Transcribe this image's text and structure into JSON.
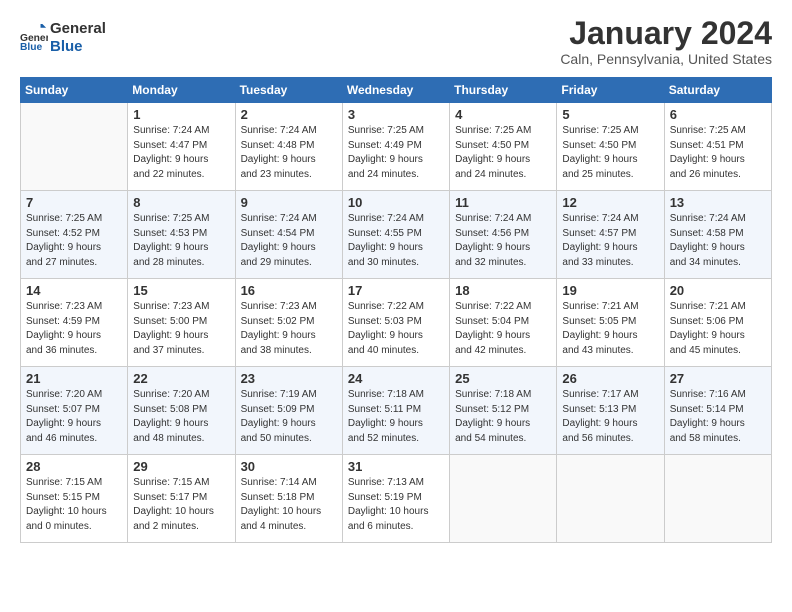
{
  "header": {
    "logo_line1": "General",
    "logo_line2": "Blue",
    "title": "January 2024",
    "location": "Caln, Pennsylvania, United States"
  },
  "days_of_week": [
    "Sunday",
    "Monday",
    "Tuesday",
    "Wednesday",
    "Thursday",
    "Friday",
    "Saturday"
  ],
  "weeks": [
    [
      {
        "num": "",
        "info": ""
      },
      {
        "num": "1",
        "info": "Sunrise: 7:24 AM\nSunset: 4:47 PM\nDaylight: 9 hours\nand 22 minutes."
      },
      {
        "num": "2",
        "info": "Sunrise: 7:24 AM\nSunset: 4:48 PM\nDaylight: 9 hours\nand 23 minutes."
      },
      {
        "num": "3",
        "info": "Sunrise: 7:25 AM\nSunset: 4:49 PM\nDaylight: 9 hours\nand 24 minutes."
      },
      {
        "num": "4",
        "info": "Sunrise: 7:25 AM\nSunset: 4:50 PM\nDaylight: 9 hours\nand 24 minutes."
      },
      {
        "num": "5",
        "info": "Sunrise: 7:25 AM\nSunset: 4:50 PM\nDaylight: 9 hours\nand 25 minutes."
      },
      {
        "num": "6",
        "info": "Sunrise: 7:25 AM\nSunset: 4:51 PM\nDaylight: 9 hours\nand 26 minutes."
      }
    ],
    [
      {
        "num": "7",
        "info": "Sunrise: 7:25 AM\nSunset: 4:52 PM\nDaylight: 9 hours\nand 27 minutes."
      },
      {
        "num": "8",
        "info": "Sunrise: 7:25 AM\nSunset: 4:53 PM\nDaylight: 9 hours\nand 28 minutes."
      },
      {
        "num": "9",
        "info": "Sunrise: 7:24 AM\nSunset: 4:54 PM\nDaylight: 9 hours\nand 29 minutes."
      },
      {
        "num": "10",
        "info": "Sunrise: 7:24 AM\nSunset: 4:55 PM\nDaylight: 9 hours\nand 30 minutes."
      },
      {
        "num": "11",
        "info": "Sunrise: 7:24 AM\nSunset: 4:56 PM\nDaylight: 9 hours\nand 32 minutes."
      },
      {
        "num": "12",
        "info": "Sunrise: 7:24 AM\nSunset: 4:57 PM\nDaylight: 9 hours\nand 33 minutes."
      },
      {
        "num": "13",
        "info": "Sunrise: 7:24 AM\nSunset: 4:58 PM\nDaylight: 9 hours\nand 34 minutes."
      }
    ],
    [
      {
        "num": "14",
        "info": "Sunrise: 7:23 AM\nSunset: 4:59 PM\nDaylight: 9 hours\nand 36 minutes."
      },
      {
        "num": "15",
        "info": "Sunrise: 7:23 AM\nSunset: 5:00 PM\nDaylight: 9 hours\nand 37 minutes."
      },
      {
        "num": "16",
        "info": "Sunrise: 7:23 AM\nSunset: 5:02 PM\nDaylight: 9 hours\nand 38 minutes."
      },
      {
        "num": "17",
        "info": "Sunrise: 7:22 AM\nSunset: 5:03 PM\nDaylight: 9 hours\nand 40 minutes."
      },
      {
        "num": "18",
        "info": "Sunrise: 7:22 AM\nSunset: 5:04 PM\nDaylight: 9 hours\nand 42 minutes."
      },
      {
        "num": "19",
        "info": "Sunrise: 7:21 AM\nSunset: 5:05 PM\nDaylight: 9 hours\nand 43 minutes."
      },
      {
        "num": "20",
        "info": "Sunrise: 7:21 AM\nSunset: 5:06 PM\nDaylight: 9 hours\nand 45 minutes."
      }
    ],
    [
      {
        "num": "21",
        "info": "Sunrise: 7:20 AM\nSunset: 5:07 PM\nDaylight: 9 hours\nand 46 minutes."
      },
      {
        "num": "22",
        "info": "Sunrise: 7:20 AM\nSunset: 5:08 PM\nDaylight: 9 hours\nand 48 minutes."
      },
      {
        "num": "23",
        "info": "Sunrise: 7:19 AM\nSunset: 5:09 PM\nDaylight: 9 hours\nand 50 minutes."
      },
      {
        "num": "24",
        "info": "Sunrise: 7:18 AM\nSunset: 5:11 PM\nDaylight: 9 hours\nand 52 minutes."
      },
      {
        "num": "25",
        "info": "Sunrise: 7:18 AM\nSunset: 5:12 PM\nDaylight: 9 hours\nand 54 minutes."
      },
      {
        "num": "26",
        "info": "Sunrise: 7:17 AM\nSunset: 5:13 PM\nDaylight: 9 hours\nand 56 minutes."
      },
      {
        "num": "27",
        "info": "Sunrise: 7:16 AM\nSunset: 5:14 PM\nDaylight: 9 hours\nand 58 minutes."
      }
    ],
    [
      {
        "num": "28",
        "info": "Sunrise: 7:15 AM\nSunset: 5:15 PM\nDaylight: 10 hours\nand 0 minutes."
      },
      {
        "num": "29",
        "info": "Sunrise: 7:15 AM\nSunset: 5:17 PM\nDaylight: 10 hours\nand 2 minutes."
      },
      {
        "num": "30",
        "info": "Sunrise: 7:14 AM\nSunset: 5:18 PM\nDaylight: 10 hours\nand 4 minutes."
      },
      {
        "num": "31",
        "info": "Sunrise: 7:13 AM\nSunset: 5:19 PM\nDaylight: 10 hours\nand 6 minutes."
      },
      {
        "num": "",
        "info": ""
      },
      {
        "num": "",
        "info": ""
      },
      {
        "num": "",
        "info": ""
      }
    ]
  ]
}
